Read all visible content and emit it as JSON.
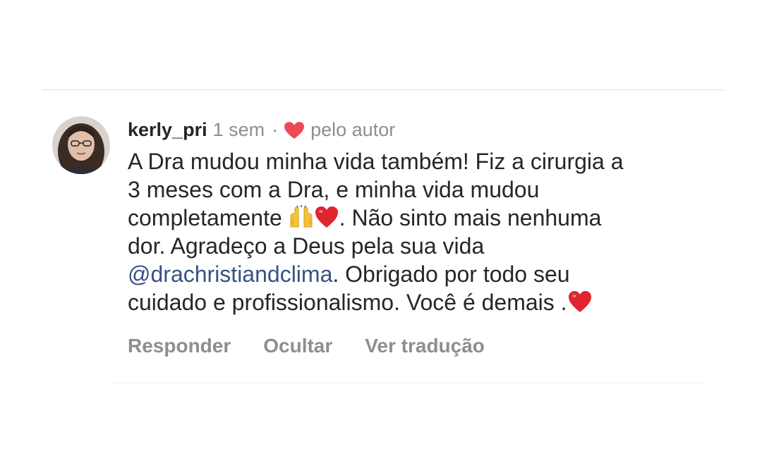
{
  "comment": {
    "username": "kerly_pri",
    "time": "1 sem",
    "separator": "·",
    "liked_by_label": "pelo autor",
    "text_part1": "A Dra mudou minha vida também! Fiz a cirurgia a\n3 meses com a Dra, e minha vida mudou\ncompletamente ",
    "text_part2": ". Não sinto mais nenhuma\ndor. Agradeço a Deus pela sua vida\n",
    "mention": "@drachristiandclima",
    "text_part3": ". Obrigado por todo seu\ncuidado  e profissionalismo. Você é demais .",
    "emojis": [
      "raising-hands-icon",
      "red-heart-icon"
    ],
    "heart_color": "#ed4956",
    "mention_color": "#385185"
  },
  "actions": {
    "reply": "Responder",
    "hide": "Ocultar",
    "translate": "Ver tradução"
  }
}
